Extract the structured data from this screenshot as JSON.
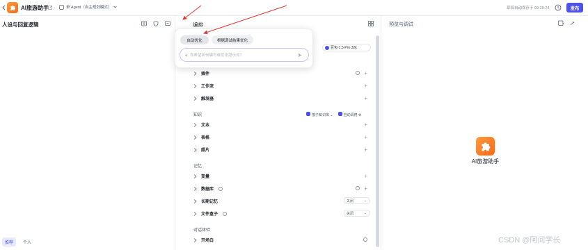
{
  "topbar": {
    "app_title": "AI旅游助手",
    "mode_label": "单 Agent（自主规划模式）",
    "saved_text": "草稿自动保存于 09:20:24",
    "publish_label": "发布"
  },
  "left_panel": {
    "title": "人设与回复逻辑",
    "tabs": [
      {
        "label": "推荐"
      },
      {
        "label": "个人"
      }
    ]
  },
  "middle_panel": {
    "title": "编排",
    "model_label": "豆包·1.5·Pro·32k",
    "rows_top": [
      {
        "label": "插件"
      },
      {
        "label": "工作流"
      },
      {
        "label": "触发器"
      }
    ],
    "knowledge_section": "知识",
    "knowledge_source": "按子知识库",
    "knowledge_auto": "自动调用",
    "rows_knowledge": [
      {
        "label": "文本"
      },
      {
        "label": "表格"
      },
      {
        "label": "照片"
      }
    ],
    "memory_section": "记忆",
    "rows_memory": [
      {
        "label": "变量"
      },
      {
        "label": "数据库"
      },
      {
        "label": "长期记忆",
        "value": "关闭"
      },
      {
        "label": "文件盒子",
        "value": "关闭"
      }
    ],
    "dialog_section": "对话体验",
    "rows_dialog": [
      {
        "label": "开场白"
      }
    ]
  },
  "popover": {
    "chip_auto": "自动优化",
    "chip_debug": "根据调试结果优化",
    "input_placeholder": "你希望如何编写或优化提示词?"
  },
  "right_panel": {
    "title": "预览与调试",
    "bot_name": "AI旅游助手"
  },
  "watermark": "CSDN @阿问学长",
  "colors": {
    "accent": "#4d53e8",
    "app_icon": "#f26b1d",
    "annotation_arrow": "#e53935"
  }
}
